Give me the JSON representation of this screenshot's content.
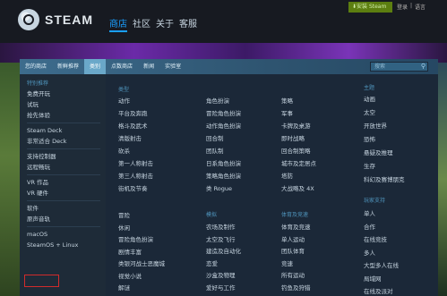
{
  "header": {
    "logo_text": "STEAM",
    "nav": [
      "商店",
      "社区",
      "关于",
      "客服"
    ],
    "install_label": "安装 Steam",
    "top_links": [
      "登录",
      "语言"
    ]
  },
  "subnav": {
    "tabs": [
      "您的商店",
      "新鲜推荐",
      "类别",
      "点数商店",
      "新闻",
      "实验室"
    ],
    "active_index": 2,
    "search_placeholder": "搜索"
  },
  "left_menu": {
    "sections": [
      {
        "title": "特别推荐",
        "items": [
          "免费开玩",
          "试玩",
          "抢先体验"
        ]
      },
      {
        "title": "",
        "items": [
          "Steam Deck",
          "非常适合 Deck"
        ]
      },
      {
        "title": "",
        "items": [
          "支持控制器",
          "远程畅玩"
        ]
      },
      {
        "title": "",
        "items": [
          "VR 作品",
          "VR 硬件"
        ]
      },
      {
        "title": "",
        "items": [
          "软件",
          "原声音轨"
        ]
      },
      {
        "title": "",
        "items": [
          "macOS",
          "SteamOS + Linux"
        ]
      }
    ],
    "highlighted_item": "macOS"
  },
  "categories": {
    "top_heading": "类型",
    "col1": [
      "动作",
      "平台及奔跑",
      "格斗及武术",
      "清版射击",
      "砍杀",
      "第一人称射击",
      "第三人称射击",
      "街机及节奏"
    ],
    "col2": [
      "角色扮演",
      "冒险角色扮演",
      "动作角色扮演",
      "回合制",
      "团队制",
      "日系角色扮演",
      "策略角色扮演",
      "类 Rogue"
    ],
    "col3": [
      "策略",
      "军事",
      "卡牌及桌游",
      "即时战略",
      "回合制策略",
      "城市及定居点",
      "塔防",
      "大战略及 4X"
    ],
    "col4_heading": "主题",
    "col4": [
      "动画",
      "太空",
      "开放世界",
      "恐怖",
      "悬疑及推理",
      "生存",
      "科幻及赛博朋克"
    ],
    "lower_col1": [
      "冒险",
      "休闲",
      "冒险角色扮演",
      "剧情丰富",
      "类银河战士恶魔城",
      "视觉小说",
      "解谜"
    ],
    "lower_col2_heading": "模拟",
    "lower_col2": [
      "农场及制作",
      "太空及飞行",
      "建造及自动化",
      "恋爱",
      "沙盒及物理",
      "爱好与工作"
    ],
    "lower_col3_heading": "体育及竞速",
    "lower_col3": [
      "体育及竞速",
      "单人运动",
      "团队体育",
      "竞速",
      "所有运动",
      "钓鱼及狩猎",
      "竞速模拟"
    ],
    "lower_col4_heading": "玩家支持",
    "lower_col4": [
      "单人",
      "合作",
      "在线竞技",
      "多人",
      "大型多人在线",
      "局域网",
      "在线及派对"
    ]
  }
}
